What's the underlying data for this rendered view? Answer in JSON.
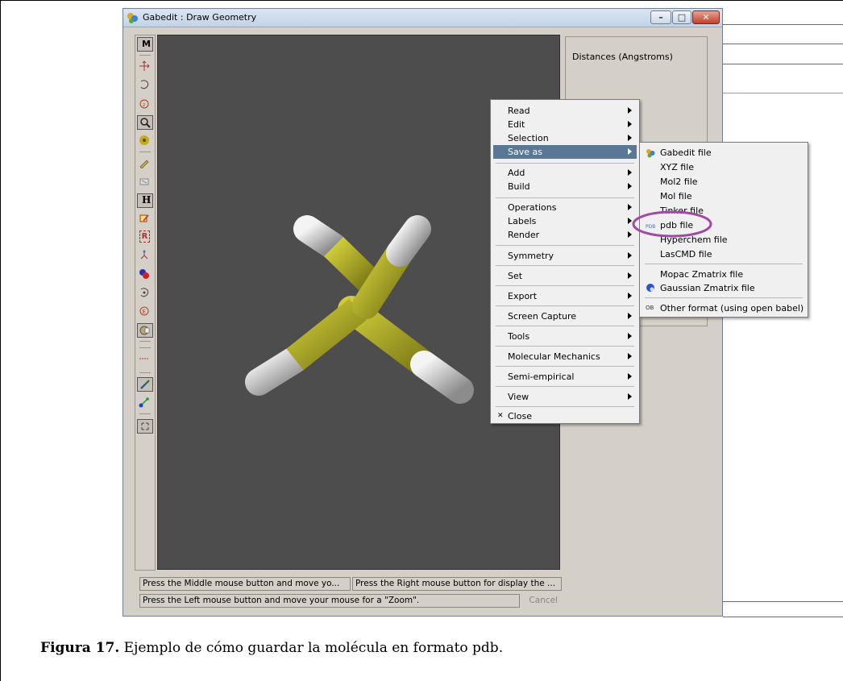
{
  "window": {
    "title": "Gabedit : Draw Geometry",
    "controls": {
      "minimize": "–",
      "maximize": "□",
      "close": "✕"
    }
  },
  "toolbar": {
    "items": [
      {
        "icon": "measure-mode-icon",
        "glyph": "M",
        "pressed": true
      },
      {
        "icon": "translate-icon"
      },
      {
        "icon": "rotate-icon"
      },
      {
        "icon": "rotate-z-icon"
      },
      {
        "icon": "zoom-icon",
        "pressed": true
      },
      {
        "icon": "scale-ball-icon"
      },
      {
        "icon": "draw-pencil-icon"
      },
      {
        "icon": "delete-icon"
      },
      {
        "icon": "add-hydrogen-icon",
        "glyph": "H",
        "pressed": true
      },
      {
        "icon": "edit-object-icon"
      },
      {
        "icon": "render-box-icon",
        "glyph": "R"
      },
      {
        "icon": "fragment-icon"
      },
      {
        "icon": "atom-ball-icon"
      },
      {
        "icon": "rotate-fragment-icon"
      },
      {
        "icon": "edit-atom-icon"
      },
      {
        "icon": "insert-fragment-icon",
        "pressed": true
      },
      {
        "icon": "bond-arrow-icon"
      },
      {
        "icon": "stick-bond-icon",
        "pressed": true
      },
      {
        "icon": "ball-stick-icon"
      },
      {
        "icon": "fullscreen-icon"
      }
    ]
  },
  "panel": {
    "header": "Distances (Angstroms)"
  },
  "status": {
    "middle": "Press the Middle mouse button and move yo...",
    "right": "Press the Right mouse button for display the ...",
    "left": "Press the Left mouse button and move your mouse for a \"Zoom\".",
    "cancel": "Cancel"
  },
  "context_menu": {
    "items": [
      {
        "label": "Read",
        "submenu": true
      },
      {
        "label": "Edit",
        "submenu": true
      },
      {
        "label": "Selection",
        "submenu": true
      },
      {
        "label": "Save as",
        "submenu": true,
        "active": true
      },
      {
        "label": "Add",
        "submenu": true
      },
      {
        "label": "Build",
        "submenu": true
      },
      {
        "label": "Operations",
        "submenu": true
      },
      {
        "label": "Labels",
        "submenu": true
      },
      {
        "label": "Render",
        "submenu": true
      },
      {
        "label": "Symmetry",
        "submenu": true
      },
      {
        "label": "Set",
        "submenu": true
      },
      {
        "label": "Export",
        "submenu": true
      },
      {
        "label": "Screen Capture",
        "submenu": true
      },
      {
        "label": "Tools",
        "submenu": true
      },
      {
        "label": "Molecular Mechanics",
        "submenu": true
      },
      {
        "label": "Semi-empirical",
        "submenu": true
      },
      {
        "label": "View",
        "submenu": true
      },
      {
        "label": "Close",
        "icon": "close-icon"
      }
    ]
  },
  "save_as_submenu": {
    "items": [
      {
        "label": "Gabedit file",
        "icon": "gabedit-icon"
      },
      {
        "label": "XYZ file"
      },
      {
        "label": "Mol2 file"
      },
      {
        "label": "Mol file"
      },
      {
        "label": "Tinker file"
      },
      {
        "label": "pdb file",
        "icon": "pdb-icon",
        "highlighted_circle": true
      },
      {
        "label": "Hyperchem file"
      },
      {
        "label": "LasCMD file"
      },
      {
        "label": "Mopac Zmatrix file"
      },
      {
        "label": "Gaussian Zmatrix file",
        "icon": "gaussian-icon"
      },
      {
        "label": "Other format (using open babel)",
        "icon": "openbabel-icon"
      }
    ]
  },
  "caption": {
    "label": "Figura 17.",
    "text": " Ejemplo de cómo guardar la molécula en formato pdb."
  },
  "colors": {
    "canvas": "#4d4d4d",
    "menu_active": "#5a7896",
    "bond_yellow": "#b6b326",
    "annotation_circle": "#a04aa8"
  }
}
